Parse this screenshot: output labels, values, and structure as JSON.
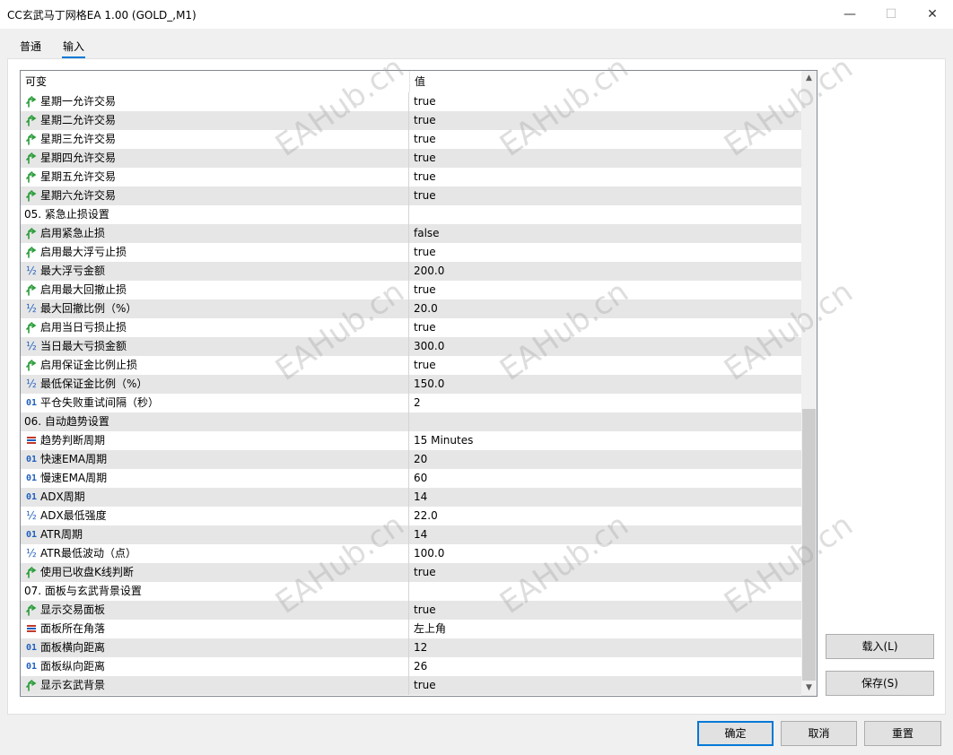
{
  "window": {
    "title": "CC玄武马丁网格EA 1.00 (GOLD_,M1)",
    "minimize": "—",
    "maximize": "☐",
    "close": "✕"
  },
  "tabs": [
    {
      "label": "普通",
      "active": false
    },
    {
      "label": "输入",
      "active": true
    }
  ],
  "grid": {
    "col_name": "可变",
    "col_value": "值",
    "rows": [
      {
        "icon": "arrow-green",
        "name": "星期一允许交易",
        "value": "true"
      },
      {
        "icon": "arrow-green",
        "name": "星期二允许交易",
        "value": "true"
      },
      {
        "icon": "arrow-green",
        "name": "星期三允许交易",
        "value": "true"
      },
      {
        "icon": "arrow-green",
        "name": "星期四允许交易",
        "value": "true"
      },
      {
        "icon": "arrow-green",
        "name": "星期五允许交易",
        "value": "true"
      },
      {
        "icon": "arrow-green",
        "name": "星期六允许交易",
        "value": "true"
      },
      {
        "icon": "none",
        "name": "05. 紧急止损设置",
        "value": ""
      },
      {
        "icon": "arrow-green",
        "name": "启用紧急止损",
        "value": "false"
      },
      {
        "icon": "arrow-green",
        "name": "启用最大浮亏止损",
        "value": "true"
      },
      {
        "icon": "half",
        "name": "最大浮亏金额",
        "value": "200.0"
      },
      {
        "icon": "arrow-green",
        "name": "启用最大回撤止损",
        "value": "true"
      },
      {
        "icon": "half",
        "name": "最大回撤比例（%）",
        "value": "20.0"
      },
      {
        "icon": "arrow-green",
        "name": "启用当日亏损止损",
        "value": "true"
      },
      {
        "icon": "half",
        "name": "当日最大亏损金额",
        "value": "300.0"
      },
      {
        "icon": "arrow-green",
        "name": "启用保证金比例止损",
        "value": "true"
      },
      {
        "icon": "half",
        "name": "最低保证金比例（%）",
        "value": "150.0"
      },
      {
        "icon": "num",
        "name": "平仓失败重试间隔（秒）",
        "value": "2"
      },
      {
        "icon": "none",
        "name": "06. 自动趋势设置",
        "value": ""
      },
      {
        "icon": "enum",
        "name": "趋势判断周期",
        "value": "15 Minutes"
      },
      {
        "icon": "num",
        "name": "快速EMA周期",
        "value": "20"
      },
      {
        "icon": "num",
        "name": "慢速EMA周期",
        "value": "60"
      },
      {
        "icon": "num",
        "name": "ADX周期",
        "value": "14"
      },
      {
        "icon": "half",
        "name": "ADX最低强度",
        "value": "22.0"
      },
      {
        "icon": "num",
        "name": "ATR周期",
        "value": "14"
      },
      {
        "icon": "half",
        "name": "ATR最低波动（点）",
        "value": "100.0"
      },
      {
        "icon": "arrow-green",
        "name": "使用已收盘K线判断",
        "value": "true"
      },
      {
        "icon": "none",
        "name": "07. 面板与玄武背景设置",
        "value": ""
      },
      {
        "icon": "arrow-green",
        "name": "显示交易面板",
        "value": "true"
      },
      {
        "icon": "enum",
        "name": "面板所在角落",
        "value": "左上角"
      },
      {
        "icon": "num",
        "name": "面板横向距离",
        "value": "12"
      },
      {
        "icon": "num",
        "name": "面板纵向距离",
        "value": "26"
      },
      {
        "icon": "arrow-green",
        "name": "显示玄武背景",
        "value": "true"
      }
    ]
  },
  "icon_glyphs": {
    "num": "01",
    "half": "½"
  },
  "side_buttons": {
    "load": "载入(L)",
    "save": "保存(S)"
  },
  "footer_buttons": {
    "ok": "确定",
    "cancel": "取消",
    "reset": "重置"
  },
  "watermark": "EAHub.cn",
  "colors": {
    "accent": "#0078d7",
    "arrow": "#2a9d3a",
    "enum": "#c0392b"
  }
}
